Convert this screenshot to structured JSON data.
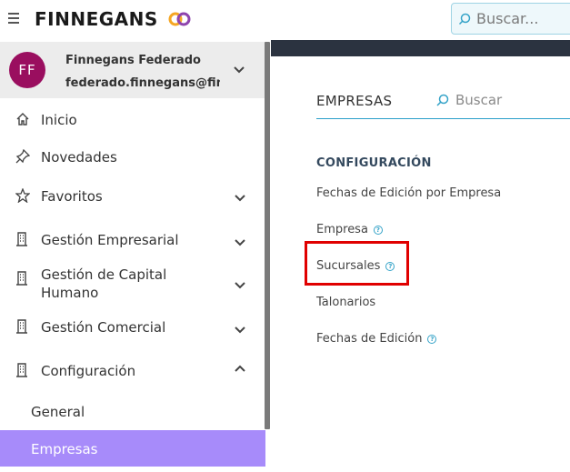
{
  "header": {
    "logo_text": "FINNEGANS",
    "search_placeholder": "Buscar..."
  },
  "user": {
    "initials": "FF",
    "name": "Finnegans Federado",
    "email": "federado.finnegans@fin...",
    "avatar_color": "#9a0e5f"
  },
  "sidebar": {
    "items": [
      {
        "label": "Inicio",
        "icon": "home-icon"
      },
      {
        "label": "Novedades",
        "icon": "pin-icon"
      },
      {
        "label": "Favoritos",
        "icon": "star-icon"
      },
      {
        "label": "Gestión Empresarial",
        "icon": "building-icon"
      },
      {
        "label_line1": "Gestión de Capital",
        "label_line2": "Humano",
        "icon": "building-icon"
      },
      {
        "label": "Gestión Comercial",
        "icon": "building-icon"
      },
      {
        "label": "Configuración",
        "icon": "building-icon"
      }
    ],
    "sub_items": [
      {
        "label": "General"
      },
      {
        "label": "Empresas",
        "active": true
      }
    ],
    "active_color": "#a78bfa"
  },
  "main": {
    "tab_title": "EMPRESAS",
    "search_placeholder": "Buscar",
    "section_title": "CONFIGURACIÓN",
    "links": [
      {
        "label": "Fechas de Edición por Empresa"
      },
      {
        "label": "Empresa",
        "help_icon": true
      },
      {
        "label": "Sucursales",
        "help_icon": true,
        "highlighted": true
      },
      {
        "label": "Talonarios"
      },
      {
        "label": "Fechas de Edición",
        "help_icon": true
      }
    ],
    "accent_color": "#2b9fc9",
    "highlight_color": "#e00000"
  }
}
